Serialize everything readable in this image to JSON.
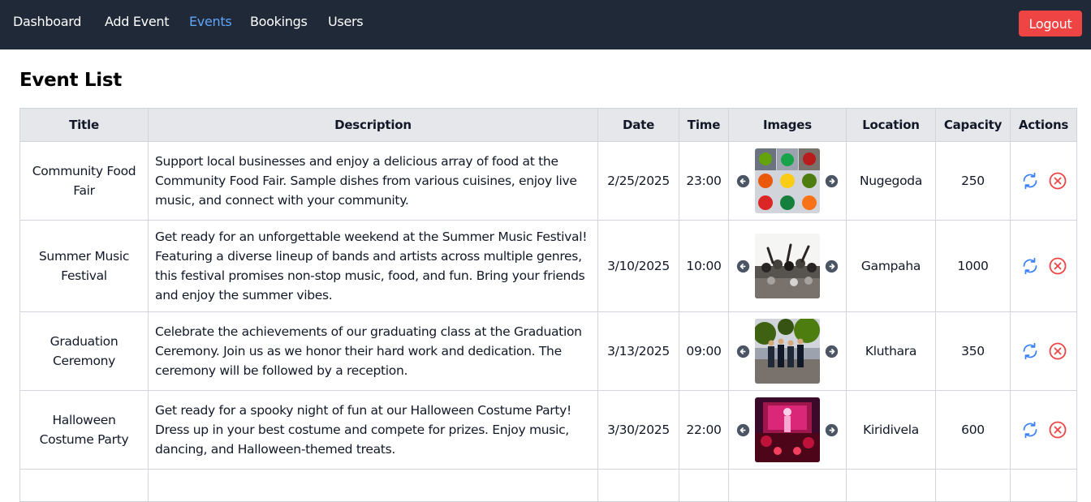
{
  "nav": {
    "links": [
      {
        "label": "Dashboard",
        "active": false
      },
      {
        "label": "Add Event",
        "active": false
      },
      {
        "label": "Events",
        "active": true
      },
      {
        "label": "Bookings",
        "active": false
      },
      {
        "label": "Users",
        "active": false
      }
    ],
    "logout_label": "Logout"
  },
  "page": {
    "title": "Event List"
  },
  "table": {
    "headers": [
      "Title",
      "Description",
      "Date",
      "Time",
      "Images",
      "Location",
      "Capacity",
      "Actions"
    ],
    "rows": [
      {
        "title": "Community Food Fair",
        "description": "Support local businesses and enjoy a delicious array of food at the Community Food Fair. Sample dishes from various cuisines, enjoy live music, and connect with your community.",
        "date": "2/25/2025",
        "time": "23:00",
        "location": "Nugegoda",
        "capacity": "250"
      },
      {
        "title": "Summer Music Festival",
        "description": "Get ready for an unforgettable weekend at the Summer Music Festival! Featuring a diverse lineup of bands and artists across multiple genres, this festival promises non-stop music, food, and fun. Bring your friends and enjoy the summer vibes.",
        "date": "3/10/2025",
        "time": "10:00",
        "location": "Gampaha",
        "capacity": "1000"
      },
      {
        "title": "Graduation Ceremony",
        "description": "Celebrate the achievements of our graduating class at the Graduation Ceremony. Join us as we honor their hard work and dedication. The ceremony will be followed by a reception.",
        "date": "3/13/2025",
        "time": "09:00",
        "location": "Kluthara",
        "capacity": "350"
      },
      {
        "title": "Halloween Costume Party",
        "description": "Get ready for a spooky night of fun at our Halloween Costume Party! Dress up in your best costume and compete for prizes. Enjoy music, dancing, and Halloween-themed treats.",
        "date": "3/30/2025",
        "time": "22:00",
        "location": "Kiridivela",
        "capacity": "600"
      }
    ]
  },
  "icons": {
    "prev": "arrow-left-circle-icon",
    "next": "arrow-right-circle-icon",
    "update": "refresh-icon",
    "delete": "close-circle-icon"
  },
  "colors": {
    "navbar_bg": "#1f2937",
    "nav_active": "#60a5fa",
    "logout_bg": "#ef4444",
    "header_bg": "#e5e7eb",
    "update_icon": "#3b82f6",
    "delete_icon": "#ef4444"
  }
}
